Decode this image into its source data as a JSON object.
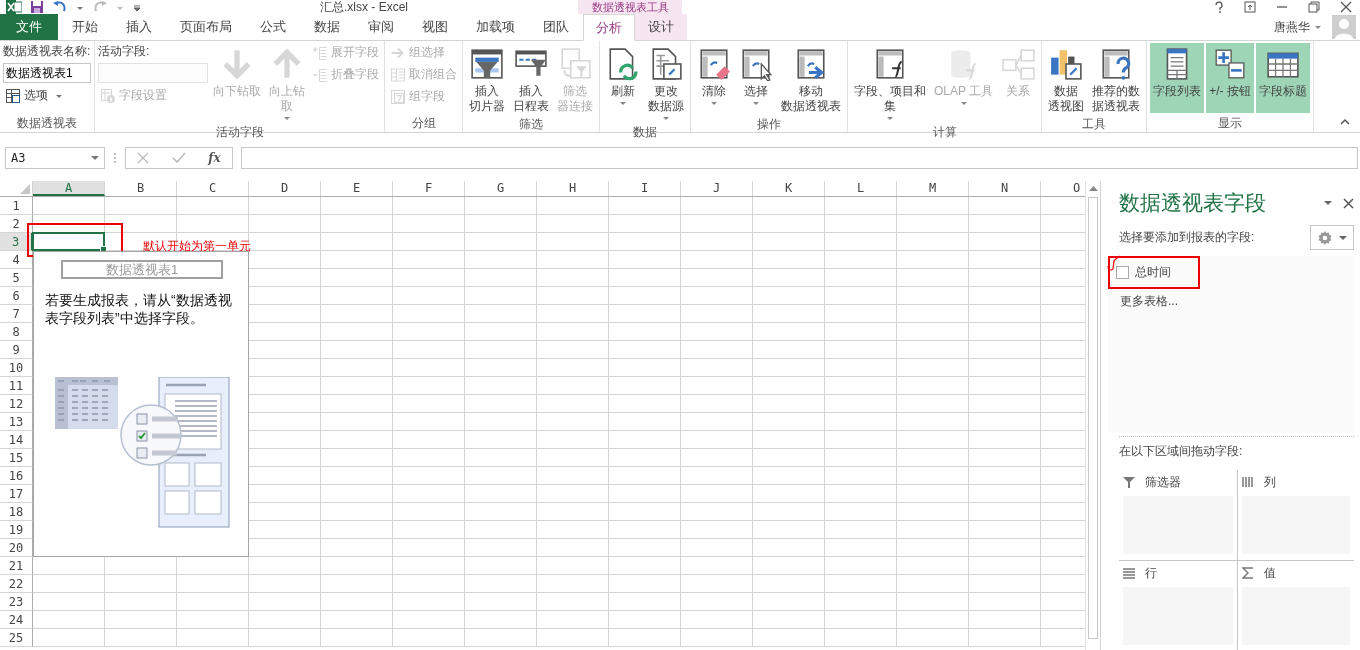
{
  "window": {
    "title": "汇总.xlsx - Excel",
    "context_label": "数据透视表工具",
    "user": "唐燕华"
  },
  "tabs": [
    {
      "label": "文件",
      "kind": "file",
      "selected": false
    },
    {
      "label": "开始",
      "kind": "normal",
      "selected": false
    },
    {
      "label": "插入",
      "kind": "normal",
      "selected": false
    },
    {
      "label": "页面布局",
      "kind": "normal",
      "selected": false
    },
    {
      "label": "公式",
      "kind": "normal",
      "selected": false
    },
    {
      "label": "数据",
      "kind": "normal",
      "selected": false
    },
    {
      "label": "审阅",
      "kind": "normal",
      "selected": false
    },
    {
      "label": "视图",
      "kind": "normal",
      "selected": false
    },
    {
      "label": "加载项",
      "kind": "normal",
      "selected": false
    },
    {
      "label": "团队",
      "kind": "normal",
      "selected": false
    },
    {
      "label": "分析",
      "kind": "context",
      "selected": true
    },
    {
      "label": "设计",
      "kind": "context",
      "selected": false
    }
  ],
  "ribbon_groups": [
    {
      "label": "数据透视表",
      "columns": [
        [
          {
            "kind": "label",
            "text": "数据透视表名称:"
          },
          {
            "kind": "field",
            "value": "数据透视表1",
            "disabled": false
          },
          {
            "kind": "small",
            "label": "选项",
            "dropdown": true,
            "disabled": false
          }
        ]
      ]
    },
    {
      "label": "活动字段",
      "columns": [
        [
          {
            "kind": "label",
            "text": "活动字段:"
          },
          {
            "kind": "field",
            "disabled": true
          },
          {
            "kind": "small",
            "label": "字段设置",
            "dropdown": false,
            "disabled": true
          }
        ],
        [
          {
            "kind": "large",
            "lines": [
              "向下钻取"
            ],
            "dropdown": false,
            "disabled": true
          }
        ],
        [
          {
            "kind": "large",
            "lines": [
              "向上钻",
              "取"
            ],
            "dropdown": true,
            "disabled": true
          }
        ],
        [
          {
            "kind": "small",
            "label": "展开字段",
            "dropdown": false,
            "disabled": true
          },
          {
            "kind": "small",
            "label": "折叠字段",
            "dropdown": false,
            "disabled": true
          }
        ]
      ]
    },
    {
      "label": "分组",
      "columns": [
        [
          {
            "kind": "small",
            "label": "组选择",
            "dropdown": false,
            "disabled": true
          },
          {
            "kind": "small",
            "label": "取消组合",
            "dropdown": false,
            "disabled": true
          },
          {
            "kind": "small",
            "label": "组字段",
            "dropdown": false,
            "disabled": true
          }
        ]
      ]
    },
    {
      "label": "筛选",
      "columns": [
        [
          {
            "kind": "large",
            "lines": [
              "插入",
              "切片器"
            ],
            "dropdown": false,
            "disabled": false
          }
        ],
        [
          {
            "kind": "large",
            "lines": [
              "插入",
              "日程表"
            ],
            "dropdown": false,
            "disabled": false
          }
        ],
        [
          {
            "kind": "large",
            "lines": [
              "筛选",
              "器连接"
            ],
            "dropdown": false,
            "disabled": true
          }
        ]
      ]
    },
    {
      "label": "数据",
      "columns": [
        [
          {
            "kind": "large",
            "lines": [
              "刷新"
            ],
            "dropdown": true,
            "disabled": false
          }
        ],
        [
          {
            "kind": "large",
            "lines": [
              "更改",
              "数据源"
            ],
            "dropdown": true,
            "disabled": false
          }
        ]
      ]
    },
    {
      "label": "操作",
      "columns": [
        [
          {
            "kind": "large",
            "lines": [
              "清除"
            ],
            "dropdown": true,
            "disabled": false
          }
        ],
        [
          {
            "kind": "large",
            "lines": [
              "选择"
            ],
            "dropdown": true,
            "disabled": false
          }
        ],
        [
          {
            "kind": "large",
            "lines": [
              "移动",
              "数据透视表"
            ],
            "dropdown": false,
            "disabled": false
          }
        ]
      ]
    },
    {
      "label": "计算",
      "columns": [
        [
          {
            "kind": "large",
            "lines": [
              "字段、项目和",
              "集"
            ],
            "dropdown": true,
            "disabled": false
          }
        ],
        [
          {
            "kind": "large",
            "lines": [
              "OLAP 工具"
            ],
            "dropdown": true,
            "disabled": true
          }
        ],
        [
          {
            "kind": "large",
            "lines": [
              "关系"
            ],
            "dropdown": false,
            "disabled": true
          }
        ]
      ]
    },
    {
      "label": "工具",
      "columns": [
        [
          {
            "kind": "large",
            "lines": [
              "数据",
              "透视图"
            ],
            "dropdown": false,
            "disabled": false
          }
        ],
        [
          {
            "kind": "large",
            "lines": [
              "推荐的数",
              "据透视表"
            ],
            "dropdown": false,
            "disabled": false
          }
        ]
      ]
    },
    {
      "label": "显示",
      "columns": [
        [
          {
            "kind": "large",
            "lines": [
              "字段列表"
            ],
            "dropdown": false,
            "disabled": false,
            "selected": true
          }
        ],
        [
          {
            "kind": "large",
            "lines": [
              "+/- 按钮"
            ],
            "dropdown": false,
            "disabled": false,
            "selected": true
          }
        ],
        [
          {
            "kind": "large",
            "lines": [
              "字段标题"
            ],
            "dropdown": false,
            "disabled": false,
            "selected": true
          }
        ]
      ]
    }
  ],
  "formula_bar": {
    "name_box": "A3",
    "insert_function": "fx"
  },
  "sheet": {
    "columns": [
      {
        "label": "A",
        "selected": true
      },
      {
        "label": "B",
        "selected": false
      },
      {
        "label": "C",
        "selected": false
      },
      {
        "label": "D",
        "selected": false
      },
      {
        "label": "E",
        "selected": false
      },
      {
        "label": "F",
        "selected": false
      },
      {
        "label": "G",
        "selected": false
      },
      {
        "label": "H",
        "selected": false
      },
      {
        "label": "I",
        "selected": false
      },
      {
        "label": "J",
        "selected": false
      },
      {
        "label": "K",
        "selected": false
      },
      {
        "label": "L",
        "selected": false
      },
      {
        "label": "M",
        "selected": false
      },
      {
        "label": "N",
        "selected": false
      },
      {
        "label": "O",
        "selected": false
      }
    ],
    "rows": [
      {
        "label": "1",
        "selected": false
      },
      {
        "label": "2",
        "selected": false
      },
      {
        "label": "3",
        "selected": true
      },
      {
        "label": "4",
        "selected": false
      },
      {
        "label": "5",
        "selected": false
      },
      {
        "label": "6",
        "selected": false
      },
      {
        "label": "7",
        "selected": false
      },
      {
        "label": "8",
        "selected": false
      },
      {
        "label": "9",
        "selected": false
      },
      {
        "label": "10",
        "selected": false
      },
      {
        "label": "11",
        "selected": false
      },
      {
        "label": "12",
        "selected": false
      },
      {
        "label": "13",
        "selected": false
      },
      {
        "label": "14",
        "selected": false
      },
      {
        "label": "15",
        "selected": false
      },
      {
        "label": "16",
        "selected": false
      },
      {
        "label": "17",
        "selected": false
      },
      {
        "label": "18",
        "selected": false
      },
      {
        "label": "19",
        "selected": false
      },
      {
        "label": "20",
        "selected": false
      },
      {
        "label": "21",
        "selected": false
      },
      {
        "label": "22",
        "selected": false
      },
      {
        "label": "23",
        "selected": false
      },
      {
        "label": "24",
        "selected": false
      },
      {
        "label": "25",
        "selected": false
      }
    ],
    "pivot_placeholder": {
      "title": "数据透视表1",
      "message": "若要生成报表，请从“数据透视表字段列表”中选择字段。"
    },
    "annotation": "默认开始为第一单元"
  },
  "field_pane": {
    "title": "数据透视表字段",
    "prompt": "选择要添加到报表的字段:",
    "fields": [
      {
        "label": "总时间",
        "checked": false
      }
    ],
    "more_tables": "更多表格...",
    "areas_prompt": "在以下区域间拖动字段:",
    "areas": [
      {
        "label": "筛选器",
        "kind": "filters"
      },
      {
        "label": "列",
        "kind": "columns"
      },
      {
        "label": "行",
        "kind": "rows"
      },
      {
        "label": "值",
        "kind": "values"
      }
    ]
  }
}
